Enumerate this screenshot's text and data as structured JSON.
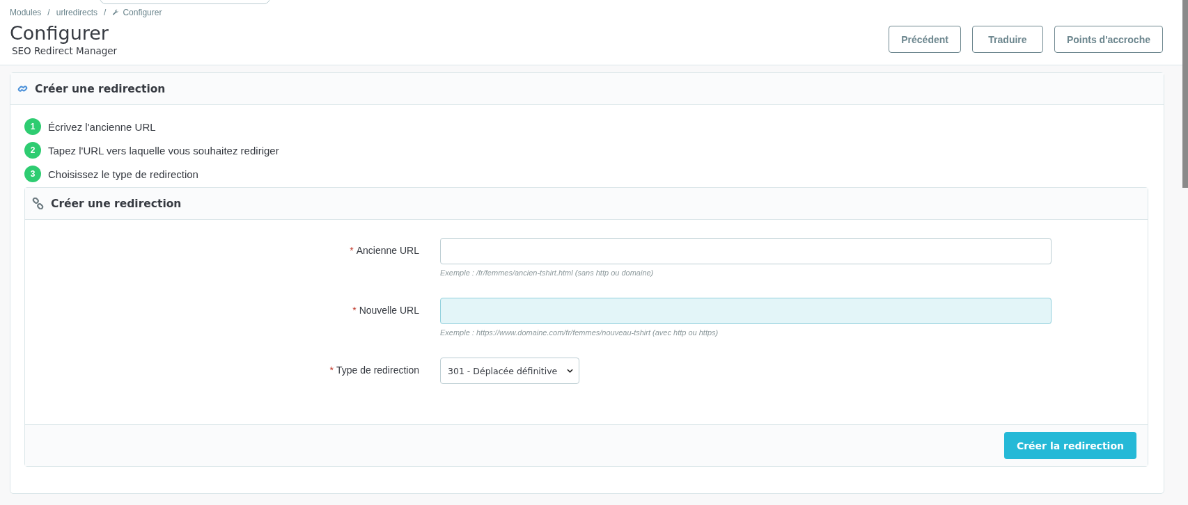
{
  "breadcrumb": {
    "separator": "/",
    "items": [
      {
        "label": "Modules",
        "kind": "link"
      },
      {
        "label": "urlredirects",
        "kind": "link"
      },
      {
        "label": "Configurer",
        "kind": "current"
      }
    ]
  },
  "page_title": "Configurer",
  "subtitle": "SEO Redirect Manager",
  "toolbar_buttons": [
    "Précédent",
    "Traduire",
    "Points d'accroche"
  ],
  "panel": {
    "title": "Créer une redirection",
    "steps": [
      {
        "number": "1",
        "text": "Écrivez l'ancienne URL"
      },
      {
        "number": "2",
        "text": "Tapez l'URL vers laquelle vous souhaitez rediriger"
      },
      {
        "number": "3",
        "text": "Choisissez le type de redirection"
      }
    ],
    "form": {
      "title": "Créer une redirection",
      "fields": [
        {
          "kind": "text",
          "label": "Ancienne URL",
          "required_mark": "*",
          "focused": false,
          "help": "Exemple : /fr/femmes/ancien-tshirt.html (sans http ou domaine)"
        },
        {
          "kind": "text",
          "label": "Nouvelle URL",
          "required_mark": "*",
          "focused": true,
          "help": "Exemple : https://www.domaine.com/fr/femmes/nouveau-tshirt (avec http ou https)"
        },
        {
          "kind": "select",
          "label": "Type de redirection",
          "required_mark": "*",
          "value": "301 - Déplacée définitive"
        }
      ],
      "submit": "Créer la redirection"
    }
  }
}
